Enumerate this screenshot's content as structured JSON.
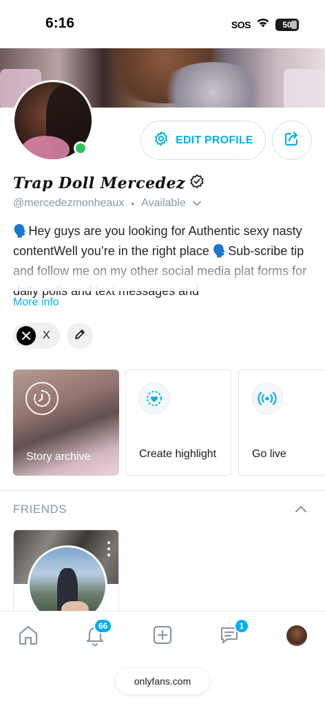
{
  "status_bar": {
    "time": "6:16",
    "sos": "SOS",
    "battery": "50"
  },
  "profile": {
    "display_name": "Trap Doll Mercedez",
    "handle": "@mercedezmonheaux",
    "availability": "Available",
    "edit_profile_label": "EDIT PROFILE",
    "bio": "🗣️Hey guys are you looking for Authentic sexy nasty contentWell you’re in the right place 🗣️Sub-scribe tip and follow me on my other social media plat forms for daily polls and text messages and",
    "more_info_label": "More info",
    "social_x_label": "X"
  },
  "tiles": {
    "story_archive": "Story archive",
    "create_highlight": "Create highlight",
    "go_live": "Go live"
  },
  "friends": {
    "title": "FRIENDS"
  },
  "tabbar": {
    "notifications_count": "66",
    "messages_count": "1"
  },
  "browser": {
    "url": "onlyfans.com"
  },
  "colors": {
    "accent": "#00aff0",
    "online": "#32c05a",
    "muted": "#8a96a3"
  },
  "icons": [
    "gear-icon",
    "share-icon",
    "verified-icon",
    "chevron-down-icon",
    "x-logo-icon",
    "pencil-icon",
    "clock-icon",
    "heart-plus-icon",
    "broadcast-icon",
    "chevron-up-icon",
    "home-icon",
    "bell-icon",
    "plus-square-icon",
    "chat-icon",
    "more-icon"
  ]
}
